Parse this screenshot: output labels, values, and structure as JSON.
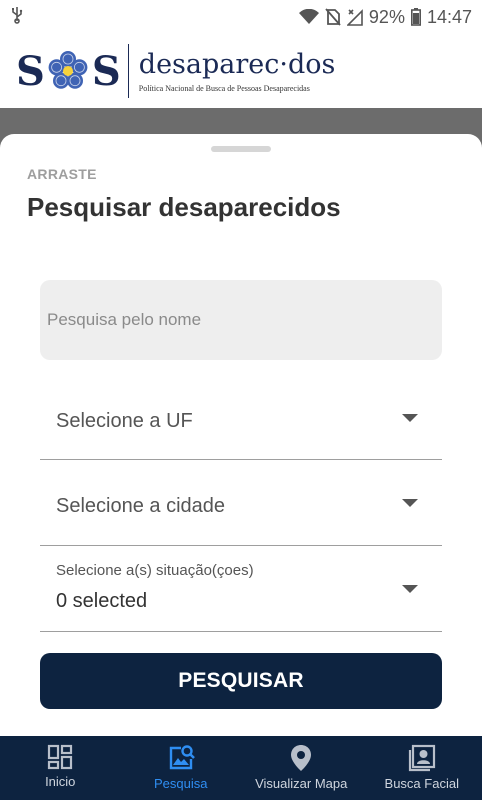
{
  "status_bar": {
    "battery": "92%",
    "time": "14:47"
  },
  "header": {
    "logo_left": "S",
    "logo_right": "S",
    "brand_word": "desaparec·dos",
    "brand_subtitle": "Política Nacional de Busca de Pessoas Desaparecidas"
  },
  "sheet": {
    "drag_label": "ARRASTE",
    "title": "Pesquisar desaparecidos",
    "name_placeholder": "Pesquisa pelo nome",
    "uf_select": "Selecione a UF",
    "city_select": "Selecione a cidade",
    "status_select_label": "Selecione a(s) situação(çoes)",
    "status_select_value": "0 selected",
    "search_button": "PESQUISAR"
  },
  "nav": {
    "items": [
      {
        "label": "Inicio",
        "icon": "dashboard-icon",
        "active": false
      },
      {
        "label": "Pesquisa",
        "icon": "image-search-icon",
        "active": true
      },
      {
        "label": "Visualizar Mapa",
        "icon": "map-pin-icon",
        "active": false
      },
      {
        "label": "Busca Facial",
        "icon": "portrait-icon",
        "active": false
      }
    ]
  },
  "colors": {
    "primary_dark": "#0d2340",
    "active_tab": "#2f8ef2",
    "brand": "#1b2a55"
  }
}
